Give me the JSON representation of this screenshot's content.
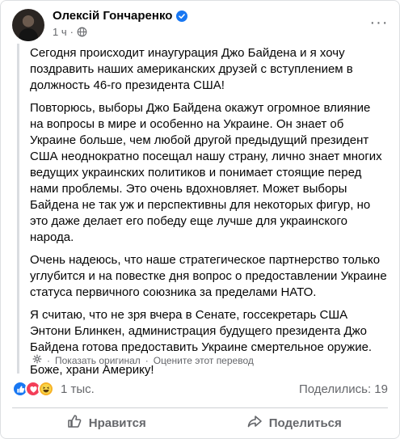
{
  "post": {
    "author": "Олексій Гончаренко",
    "time": "1 ч",
    "meta_separator": "·",
    "more_label": "···",
    "paragraphs": [
      "Сегодня происходит инаугурация Джо Байдена и я хочу поздравить наших американских друзей с вступлением в должность 46-го президента США!",
      "Повторюсь, выборы Джо Байдена окажут огромное влияние на вопросы в мире и особенно на Украине. Он знает об Украине больше, чем любой другой предыдущий президент США неоднократно посещал нашу страну, лично знает многих ведущих украинских политиков и понимает стоящие перед нами проблемы. Это очень вдохновляет. Может выборы Байдена не так уж и перспективны для некоторых фигур, но это даже делает его победу еще лучше для украинского народа.",
      "Очень надеюсь, что наше стратегическое партнерство только углубится и на повестке дня вопрос о предоставлении Украине статуса первичного союзника за пределами НАТО.",
      "Я считаю, что не зря вчера в Сенате, госсекретарь США Энтони Блинкен, администрация будущего президента Джо Байдена готова предоставить Украине смертельное оружие.",
      "Боже, храни Америку!"
    ],
    "show_original": "Показать оригинал",
    "rate_translation": "Оцените этот перевод",
    "dot": "·"
  },
  "reactions": {
    "count": "1 тыс.",
    "shares": "Поделились: 19",
    "types": [
      "like-icon",
      "love-icon",
      "haha-icon"
    ]
  },
  "actions": {
    "like_label": "Нравится",
    "share_label": "Поделиться"
  },
  "colors": {
    "accent": "#1877f2",
    "muted_text": "#65676b",
    "love": "#f33e58",
    "haha": "#f7b125"
  }
}
